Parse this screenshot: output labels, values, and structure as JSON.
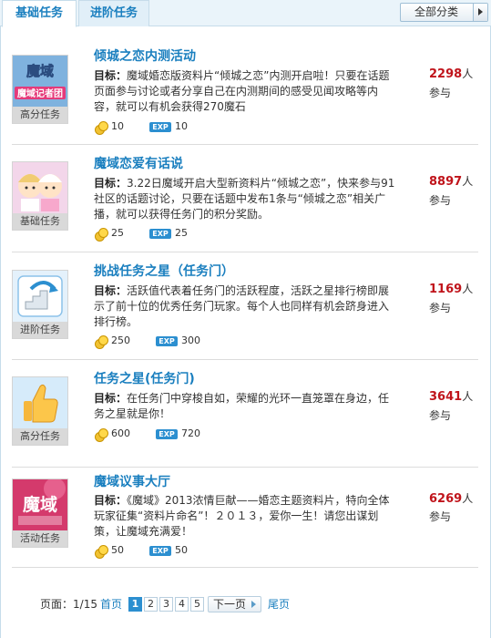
{
  "tabs": [
    {
      "label": "基础任务",
      "active": true
    },
    {
      "label": "进阶任务",
      "active": false
    }
  ],
  "category_select": {
    "selected": "全部分类"
  },
  "tasks": [
    {
      "title": "倾城之恋内测活动",
      "thumb_label": "高分任务",
      "thumb_text": "魔域记者团",
      "desc_label": "目标：",
      "desc": "魔域婚恋版资料片“倾城之恋”内测开启啦！只要在话题页面参与讨论或者分享自己在内测期间的感受见闻攻略等内容，就可以有机会获得270魔石",
      "coins": "10",
      "exp": "10",
      "count": "2298",
      "count_unit": "人",
      "join_label": "参与"
    },
    {
      "title": "魔域恋爱有话说",
      "thumb_label": "基础任务",
      "thumb_text": "",
      "desc_label": "目标：",
      "desc": "3.22日魔域开启大型新资料片“倾城之恋”，快来参与91社区的话题讨论，只要在话题中发布1条与“倾城之恋”相关广播，就可以获得任务门的积分奖励。",
      "coins": "25",
      "exp": "25",
      "count": "8897",
      "count_unit": "人",
      "join_label": "参与"
    },
    {
      "title": "挑战任务之星（任务门）",
      "thumb_label": "进阶任务",
      "thumb_text": "",
      "desc_label": "目标：",
      "desc": "活跃值代表着任务门的活跃程度，活跃之星排行榜即展示了前十位的优秀任务门玩家。每个人也同样有机会跻身进入排行榜。",
      "coins": "250",
      "exp": "300",
      "count": "1169",
      "count_unit": "人",
      "join_label": "参与"
    },
    {
      "title": "任务之星(任务门)",
      "thumb_label": "高分任务",
      "thumb_text": "",
      "desc_label": "目标：",
      "desc": "在任务门中穿梭自如，荣耀的光环一直笼罩在身边，任务之星就是你！",
      "coins": "600",
      "exp": "720",
      "count": "3641",
      "count_unit": "人",
      "join_label": "参与"
    },
    {
      "title": "魔域议事大厅",
      "thumb_label": "活动任务",
      "thumb_text": "魔域",
      "desc_label": "目标：",
      "desc": "《魔域》2013浓情巨献——婚恋主题资料片，特向全体玩家征集“资料片命名”！２０１３，爱你一生！请您出谋划策，让魔域充满爱！",
      "coins": "50",
      "exp": "50",
      "count": "6269",
      "count_unit": "人",
      "join_label": "参与"
    }
  ],
  "exp_badge": "EXP",
  "pagination": {
    "page_label": "页面：",
    "current": "1",
    "sep": "/",
    "total": "15",
    "first": "首页",
    "pages": [
      "1",
      "2",
      "3",
      "4",
      "5"
    ],
    "next": "下一页",
    "last": "尾页"
  },
  "colors": {
    "link": "#1a7fbf",
    "count": "#c0141b",
    "exp_badge": "#2c8fd0"
  }
}
